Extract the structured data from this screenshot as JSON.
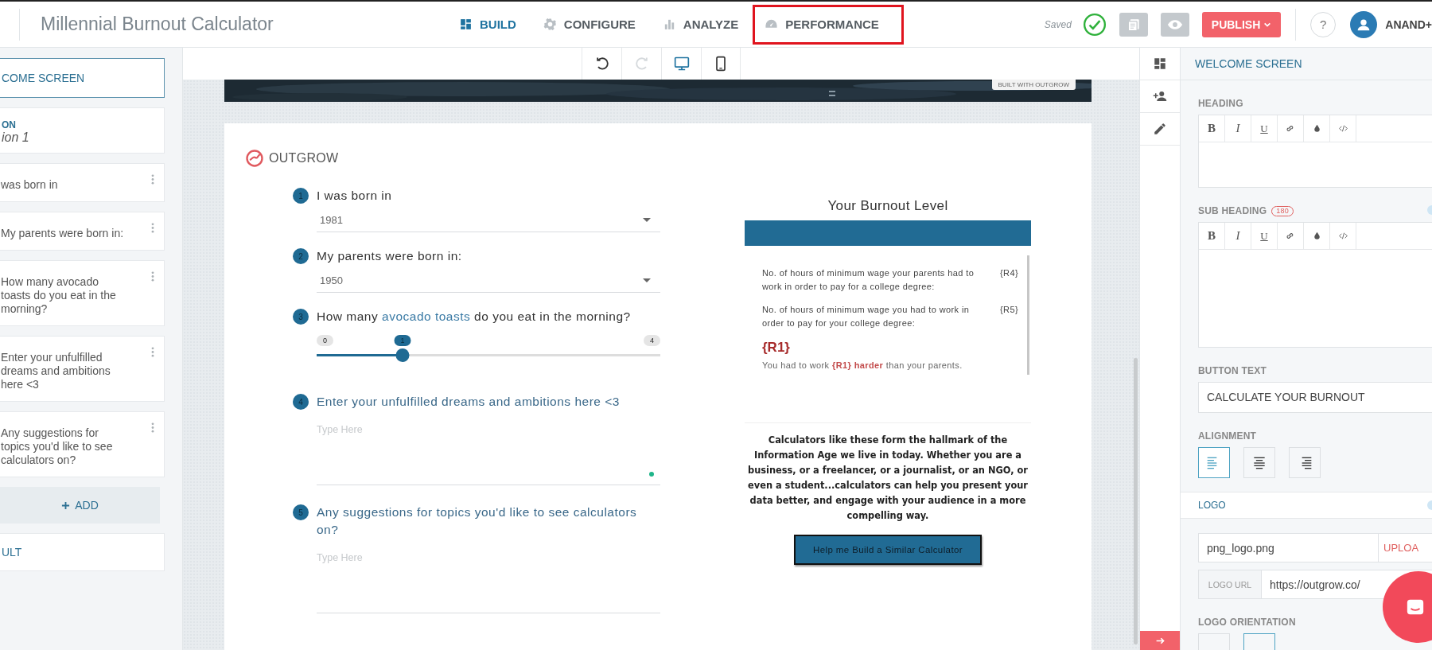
{
  "app_bar": {
    "title": "Millennial Burnout Calculator",
    "nav": [
      {
        "label": "BUILD",
        "selected": true,
        "outlined": false
      },
      {
        "label": "CONFIGURE",
        "selected": false,
        "outlined": false
      },
      {
        "label": "ANALYZE",
        "selected": false,
        "outlined": false
      },
      {
        "label": "PERFORMANCE",
        "selected": false,
        "outlined": true
      }
    ],
    "save_status": "Saved",
    "publish": "PUBLISH",
    "help": "?",
    "user": "ANAND+"
  },
  "sidebar": {
    "items": [
      {
        "kind": "screen",
        "label": "COME SCREEN",
        "selected": true
      },
      {
        "kind": "section",
        "label": "ON",
        "subtitle": "ion 1"
      },
      {
        "kind": "question",
        "label": "was born in"
      },
      {
        "kind": "question",
        "label": "My parents were born in:"
      },
      {
        "kind": "question",
        "label": "How many avocado toasts do you eat in the morning?"
      },
      {
        "kind": "question",
        "label": "Enter your unfulfilled dreams and ambitions here <3"
      },
      {
        "kind": "question",
        "label": "Any suggestions for topics you'd like to see calculators on?"
      },
      {
        "kind": "add",
        "label": "ADD"
      },
      {
        "kind": "screen",
        "label": "ULT",
        "selected": false
      }
    ]
  },
  "canvas_toolbar": [
    {
      "kind": "undo",
      "disabled": false,
      "selected": false
    },
    {
      "kind": "redo",
      "disabled": true,
      "selected": false
    },
    {
      "kind": "desktop",
      "disabled": false,
      "selected": true
    },
    {
      "kind": "mobile",
      "disabled": false,
      "selected": false
    }
  ],
  "banner": {
    "kind": "picture",
    "badge": "BUILT WITH OUTGROW"
  },
  "calculator": {
    "logo": "OUTGROW",
    "questions": [
      {
        "number": "1",
        "kind": "select",
        "label": "I was born in",
        "value": "1981"
      },
      {
        "number": "2",
        "kind": "select",
        "label": "My parents were born in:",
        "value": "1950"
      },
      {
        "number": "3",
        "kind": "slider",
        "label": "How many ",
        "highlight": "avocado toasts",
        "label_end": " do you eat in the morning?",
        "min": "0",
        "max": "4",
        "value": "1",
        "level": 0.25
      },
      {
        "number": "4",
        "kind": "text",
        "label": "Enter your unfulfilled dreams and ambitions here <3",
        "placeholder": "Type Here",
        "indicator": true
      },
      {
        "number": "5",
        "kind": "text",
        "label": "Any suggestions for topics you'd like to see calculators on?",
        "placeholder": "Type Here",
        "indicator": false
      }
    ],
    "result": {
      "title": "Your Burnout Level",
      "rows": [
        {
          "label": "No. of hours of minimum wage your parents had to work in order to pay for a college degree:",
          "value": "{R4}"
        },
        {
          "label": "No. of hours of minimum wage you had to work in order to pay for your college degree:",
          "value": "{R5}"
        }
      ],
      "big_value": "{R1}",
      "sentence": "You had to work **{R1} harder** than your parents."
    },
    "paragraph": "Calculators like these form the hallmark of the Information Age we live in today. Whether you are a business, or a freelancer, or a journalist, or an NGO, or even a student...calculators can help you present your data better, and engage with your audience in a more compelling way.",
    "cta": "Help me Build a Similar Calculator"
  },
  "tool_rail": [
    {
      "selected": false
    },
    {
      "selected": false
    },
    {
      "selected": false
    }
  ],
  "panel": {
    "title": "WELCOME SCREEN",
    "heading": {
      "label": "HEADING",
      "toolbar": [
        {
          "kind": "bold",
          "label": "B"
        },
        {
          "kind": "italic",
          "label": "I"
        },
        {
          "kind": "underline",
          "label": "U"
        },
        {
          "kind": "link"
        },
        {
          "kind": "color"
        },
        {
          "kind": "code"
        }
      ]
    },
    "sub_heading": {
      "label": "SUB HEADING",
      "badge": "180",
      "enabled": true,
      "toolbar": [
        {
          "kind": "bold",
          "label": "B"
        },
        {
          "kind": "italic",
          "label": "I"
        },
        {
          "kind": "underline",
          "label": "U"
        },
        {
          "kind": "link"
        },
        {
          "kind": "color"
        },
        {
          "kind": "code"
        }
      ]
    },
    "button_text": {
      "label": "BUTTON TEXT",
      "value": "CALCULATE YOUR BURNOUT"
    },
    "alignment": {
      "label": "ALIGNMENT",
      "options": [
        {
          "kind": "left",
          "selected": true
        },
        {
          "kind": "center",
          "selected": false
        },
        {
          "kind": "right",
          "selected": false
        }
      ]
    },
    "logo": {
      "label": "LOGO",
      "enabled": true,
      "file": "png_logo.png",
      "upload": "UPLOA",
      "url_label": "LOGO URL",
      "url": "https://outgrow.co/"
    },
    "orientation": {
      "label": "LOGO ORIENTATION"
    }
  }
}
